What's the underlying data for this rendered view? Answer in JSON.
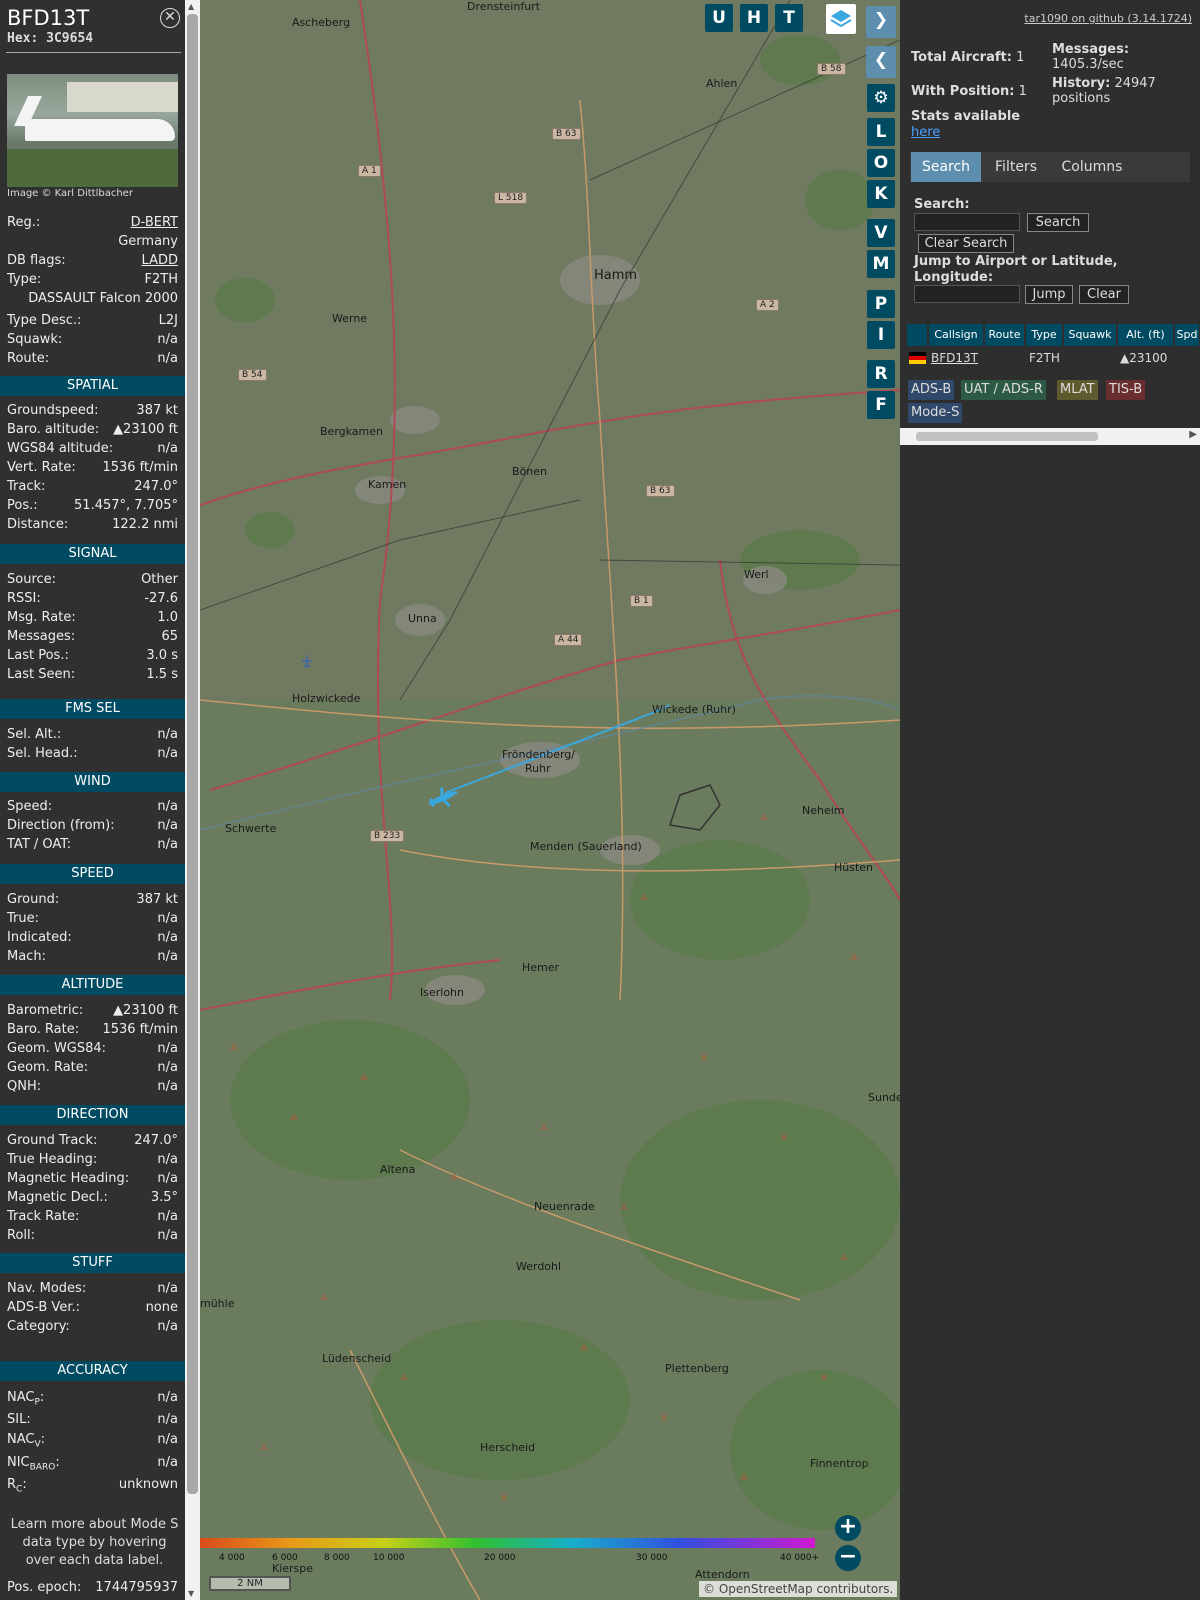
{
  "aircraft": {
    "callsign": "BFD13T",
    "hex": "Hex: 3C9654",
    "photo_credit": "Image © Karl Dittlbacher",
    "reg_label": "Reg.:",
    "reg": "D-BERT",
    "country": "Germany",
    "dbflags_label": "DB flags:",
    "dbflags": "LADD",
    "type_label": "Type:",
    "type": "F2TH",
    "type_name": "DASSAULT Falcon 2000",
    "typedesc_label": "Type Desc.:",
    "typedesc": "L2J",
    "squawk_label": "Squawk:",
    "squawk": "n/a",
    "route_label": "Route:",
    "route": "n/a"
  },
  "sections": {
    "spatial": "SPATIAL",
    "signal": "SIGNAL",
    "fms": "FMS SEL",
    "wind": "WIND",
    "speed": "SPEED",
    "altitude": "ALTITUDE",
    "direction": "DIRECTION",
    "stuff": "STUFF",
    "accuracy": "ACCURACY"
  },
  "spatial": [
    {
      "k": "Groundspeed:",
      "v": "387 kt"
    },
    {
      "k": "Baro. altitude:",
      "v": "▲23100 ft"
    },
    {
      "k": "WGS84 altitude:",
      "v": "n/a"
    },
    {
      "k": "Vert. Rate:",
      "v": "1536 ft/min"
    },
    {
      "k": "Track:",
      "v": "247.0°"
    },
    {
      "k": "Pos.:",
      "v": "51.457°, 7.705°"
    },
    {
      "k": "Distance:",
      "v": "122.2 nmi"
    }
  ],
  "signal": [
    {
      "k": "Source:",
      "v": "Other"
    },
    {
      "k": "RSSI:",
      "v": "-27.6"
    },
    {
      "k": "Msg. Rate:",
      "v": "1.0"
    },
    {
      "k": "Messages:",
      "v": "65"
    },
    {
      "k": "Last Pos.:",
      "v": "3.0 s"
    },
    {
      "k": "Last Seen:",
      "v": "1.5 s"
    }
  ],
  "fms": [
    {
      "k": "Sel. Alt.:",
      "v": "n/a"
    },
    {
      "k": "Sel. Head.:",
      "v": "n/a"
    }
  ],
  "wind": [
    {
      "k": "Speed:",
      "v": "n/a"
    },
    {
      "k": "Direction (from):",
      "v": "n/a"
    },
    {
      "k": "TAT / OAT:",
      "v": "n/a"
    }
  ],
  "speed": [
    {
      "k": "Ground:",
      "v": "387 kt"
    },
    {
      "k": "True:",
      "v": "n/a"
    },
    {
      "k": "Indicated:",
      "v": "n/a"
    },
    {
      "k": "Mach:",
      "v": "n/a"
    }
  ],
  "altitude": [
    {
      "k": "Barometric:",
      "v": "▲23100 ft"
    },
    {
      "k": "Baro. Rate:",
      "v": "1536 ft/min"
    },
    {
      "k": "Geom. WGS84:",
      "v": "n/a"
    },
    {
      "k": "Geom. Rate:",
      "v": "n/a"
    },
    {
      "k": "QNH:",
      "v": "n/a"
    }
  ],
  "direction": [
    {
      "k": "Ground Track:",
      "v": "247.0°"
    },
    {
      "k": "True Heading:",
      "v": "n/a"
    },
    {
      "k": "Magnetic Heading:",
      "v": "n/a"
    },
    {
      "k": "Magnetic Decl.:",
      "v": "3.5°"
    },
    {
      "k": "Track Rate:",
      "v": "n/a"
    },
    {
      "k": "Roll:",
      "v": "n/a"
    }
  ],
  "stuff": [
    {
      "k": "Nav. Modes:",
      "v": "n/a"
    },
    {
      "k": "ADS-B Ver.:",
      "v": "none"
    },
    {
      "k": "Category:",
      "v": "n/a"
    }
  ],
  "accuracy": {
    "nacp_k": "NAC",
    "nacp_sub": "P",
    "nacp_v": "n/a",
    "sil_k": "SIL:",
    "sil_v": "n/a",
    "nacv_k": "NAC",
    "nacv_sub": "V",
    "nacv_v": "n/a",
    "nic_k": "NIC",
    "nic_sub": "BARO",
    "nic_v": "n/a",
    "rc_k": "R",
    "rc_sub": "C",
    "rc_v": "unknown"
  },
  "note": "Learn more about Mode S data type by hovering over each data label.",
  "epoch_label": "Pos. epoch:",
  "epoch": "1744795937",
  "map": {
    "towns": [
      "Ascheberg",
      "Drensteinfurt",
      "Ahlen",
      "Hamm",
      "Werne",
      "Bergkamen",
      "Kamen",
      "Bönen",
      "Unna",
      "Werl",
      "Holzwickede",
      "Fröndenberg/",
      "Ruhr",
      "Wickede (Ruhr)",
      "Neheim",
      "Schwerte",
      "Menden (Sauerland)",
      "Hüsten",
      "Hemer",
      "Iserlohn",
      "Altena",
      "Neuenrade",
      "Werdohl",
      "Lüdenscheid",
      "Plettenberg",
      "Herscheid",
      "Finnentrop",
      "Sunde",
      "Attendorn",
      "Kierspe",
      "mühle"
    ],
    "roads": [
      "A 1",
      "L 518",
      "B 63",
      "B 58",
      "A 2",
      "B 54",
      "B 63",
      "B 1",
      "A 44",
      "B 233"
    ],
    "buttons": [
      "U",
      "H",
      "T",
      "L",
      "O",
      "K",
      "V",
      "M",
      "P",
      "I",
      "R",
      "F"
    ],
    "zoom_in": "+",
    "zoom_out": "−",
    "scale": "2 NM",
    "osm": "© OpenStreetMap contributors.",
    "alt_labels": [
      "4 000",
      "6 000",
      "8 000",
      "10 000",
      "20 000",
      "30 000",
      "40 000+"
    ]
  },
  "panel": {
    "github": "tar1090 on github (3.14.1724)",
    "total_label": "Total Aircraft:",
    "total": "1",
    "withpos_label": "With Position:",
    "withpos": "1",
    "stats_label": "Stats available",
    "stats_link": "here",
    "messages_label": "Messages:",
    "messages": "1405.3/sec",
    "history_label": "History:",
    "history": "24947",
    "history_unit": "positions",
    "tabs": [
      "Search",
      "Filters",
      "Columns"
    ],
    "search_label": "Search:",
    "search_btn": "Search",
    "clear_search_btn": "Clear Search",
    "jump_label": "Jump to Airport or Latitude, Longitude:",
    "jump_btn": "Jump",
    "clear_btn": "Clear",
    "cols": [
      "Callsign",
      "Route",
      "Type",
      "Squawk",
      "Alt. (ft)",
      "Spd"
    ],
    "row": {
      "callsign": "BFD13T",
      "route": "",
      "type": "F2TH",
      "squawk": "",
      "alt": "▲23100"
    },
    "legend": [
      "ADS-B",
      "UAT / ADS-R",
      "MLAT",
      "TIS-B",
      "Mode-S"
    ]
  },
  "colors": {
    "accent": "#004b62",
    "tab_active": "#5d8eae",
    "track": "#3aa8e0"
  }
}
